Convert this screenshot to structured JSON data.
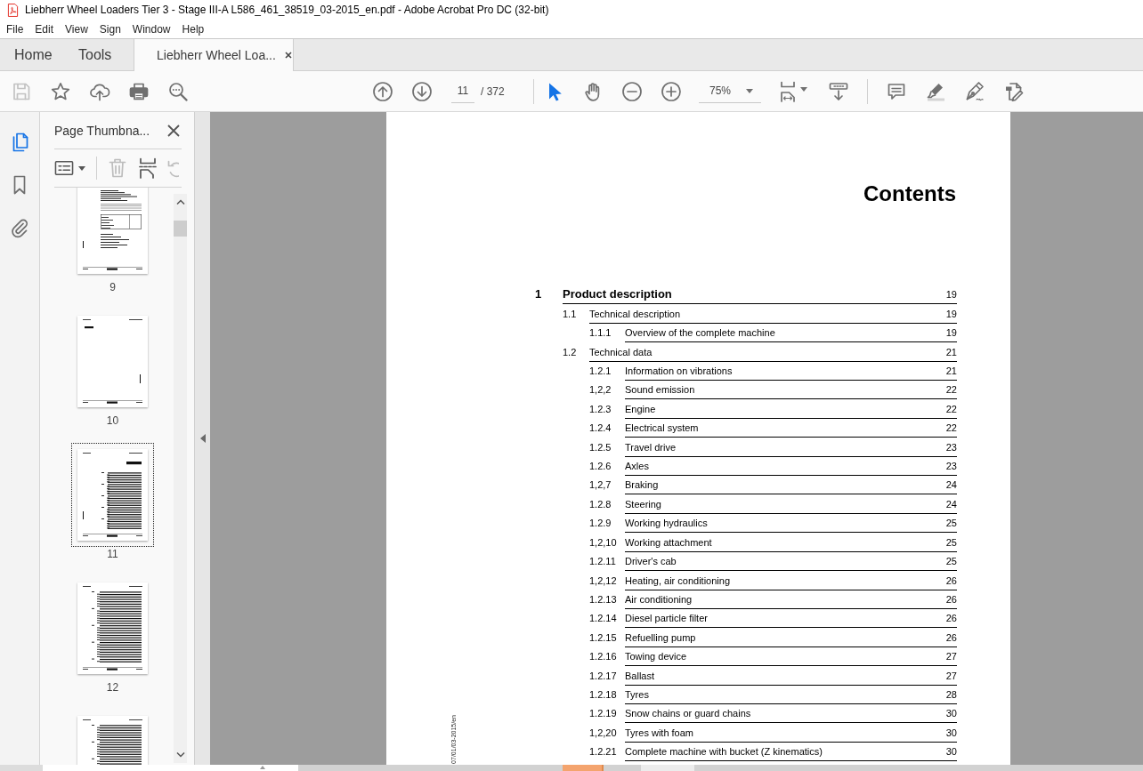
{
  "window": {
    "title": "Liebherr Wheel Loaders Tier 3 - Stage III-A L586_461_38519_03-2015_en.pdf - Adobe Acrobat Pro DC (32-bit)"
  },
  "menu": [
    "File",
    "Edit",
    "View",
    "Sign",
    "Window",
    "Help"
  ],
  "tabs": [
    {
      "label": "Home",
      "kind": "nav",
      "selected": false
    },
    {
      "label": "Tools",
      "kind": "nav",
      "selected": false
    },
    {
      "label": "Liebherr Wheel Loa...",
      "kind": "document",
      "selected": true
    }
  ],
  "toolbar": {
    "save": {
      "disabled": true
    },
    "page": {
      "current": "11",
      "total": "/ 372"
    },
    "tools": [
      {
        "kind": "select",
        "selected": true
      },
      {
        "kind": "hand",
        "selected": false
      }
    ],
    "zoom": {
      "value": "75%"
    }
  },
  "rail": [
    {
      "kind": "pages",
      "selected": true
    },
    {
      "kind": "bookmarks",
      "selected": false
    },
    {
      "kind": "attachments",
      "selected": false
    }
  ],
  "thumbnail_panel": {
    "title": "Page Thumbna...",
    "actions": [
      {
        "kind": "options",
        "disabled": false
      },
      {
        "kind": "delete",
        "disabled": true
      },
      {
        "kind": "insert",
        "disabled": false
      },
      {
        "kind": "rotate",
        "disabled": true
      }
    ],
    "pages": [
      {
        "label": "9",
        "kind": "form",
        "selected": false
      },
      {
        "label": "10",
        "kind": "notes",
        "selected": false
      },
      {
        "label": "11",
        "kind": "contents",
        "selected": true
      },
      {
        "label": "12",
        "kind": "list",
        "selected": false
      },
      {
        "kind": "list",
        "selected": false
      }
    ]
  },
  "document": {
    "heading": "Contents",
    "margin_note": "07/01/03-2015/en",
    "toc": [
      {
        "number": "1",
        "title": "Product description",
        "page": "19",
        "children": [
          {
            "number": "1.1",
            "title": "Technical description",
            "page": "19",
            "children": [
              {
                "number": "1.1.1",
                "title": "Overview of the complete machine",
                "page": "19"
              }
            ]
          },
          {
            "number": "1.2",
            "title": "Technical data",
            "page": "21",
            "children": [
              {
                "number": "1.2.1",
                "title": "Information on vibrations",
                "page": "21"
              },
              {
                "number": "1,2,2",
                "title": "Sound emission",
                "page": "22"
              },
              {
                "number": "1.2.3",
                "title": "Engine",
                "page": "22"
              },
              {
                "number": "1.2.4",
                "title": "Electrical system",
                "page": "22"
              },
              {
                "number": "1.2.5",
                "title": "Travel drive",
                "page": "23"
              },
              {
                "number": "1.2.6",
                "title": "Axles",
                "page": "23"
              },
              {
                "number": "1,2,7",
                "title": "Braking",
                "page": "24"
              },
              {
                "number": "1.2.8",
                "title": "Steering",
                "page": "24"
              },
              {
                "number": "1.2.9",
                "title": "Working hydraulics",
                "page": "25"
              },
              {
                "number": "1,2,10",
                "title": "Working attachment",
                "page": "25"
              },
              {
                "number": "1.2.11",
                "title": "Driver's cab",
                "page": "25"
              },
              {
                "number": "1,2,12",
                "title": "Heating, air conditioning",
                "page": "26"
              },
              {
                "number": "1.2.13",
                "title": "Air conditioning",
                "page": "26"
              },
              {
                "number": "1.2.14",
                "title": "Diesel particle filter",
                "page": "26"
              },
              {
                "number": "1.2.15",
                "title": "Refuelling pump",
                "page": "26"
              },
              {
                "number": "1.2.16",
                "title": "Towing device",
                "page": "27"
              },
              {
                "number": "1.2.17",
                "title": "Ballast",
                "page": "27"
              },
              {
                "number": "1.2.18",
                "title": "Tyres",
                "page": "28"
              },
              {
                "number": "1.2.19",
                "title": "Snow chains or guard chains",
                "page": "30"
              },
              {
                "number": "1,2,20",
                "title": "Tyres with foam",
                "page": "30"
              },
              {
                "number": "1.2.21",
                "title": "Complete machine with bucket (Z kinematics)",
                "page": "30"
              }
            ]
          }
        ]
      }
    ]
  }
}
